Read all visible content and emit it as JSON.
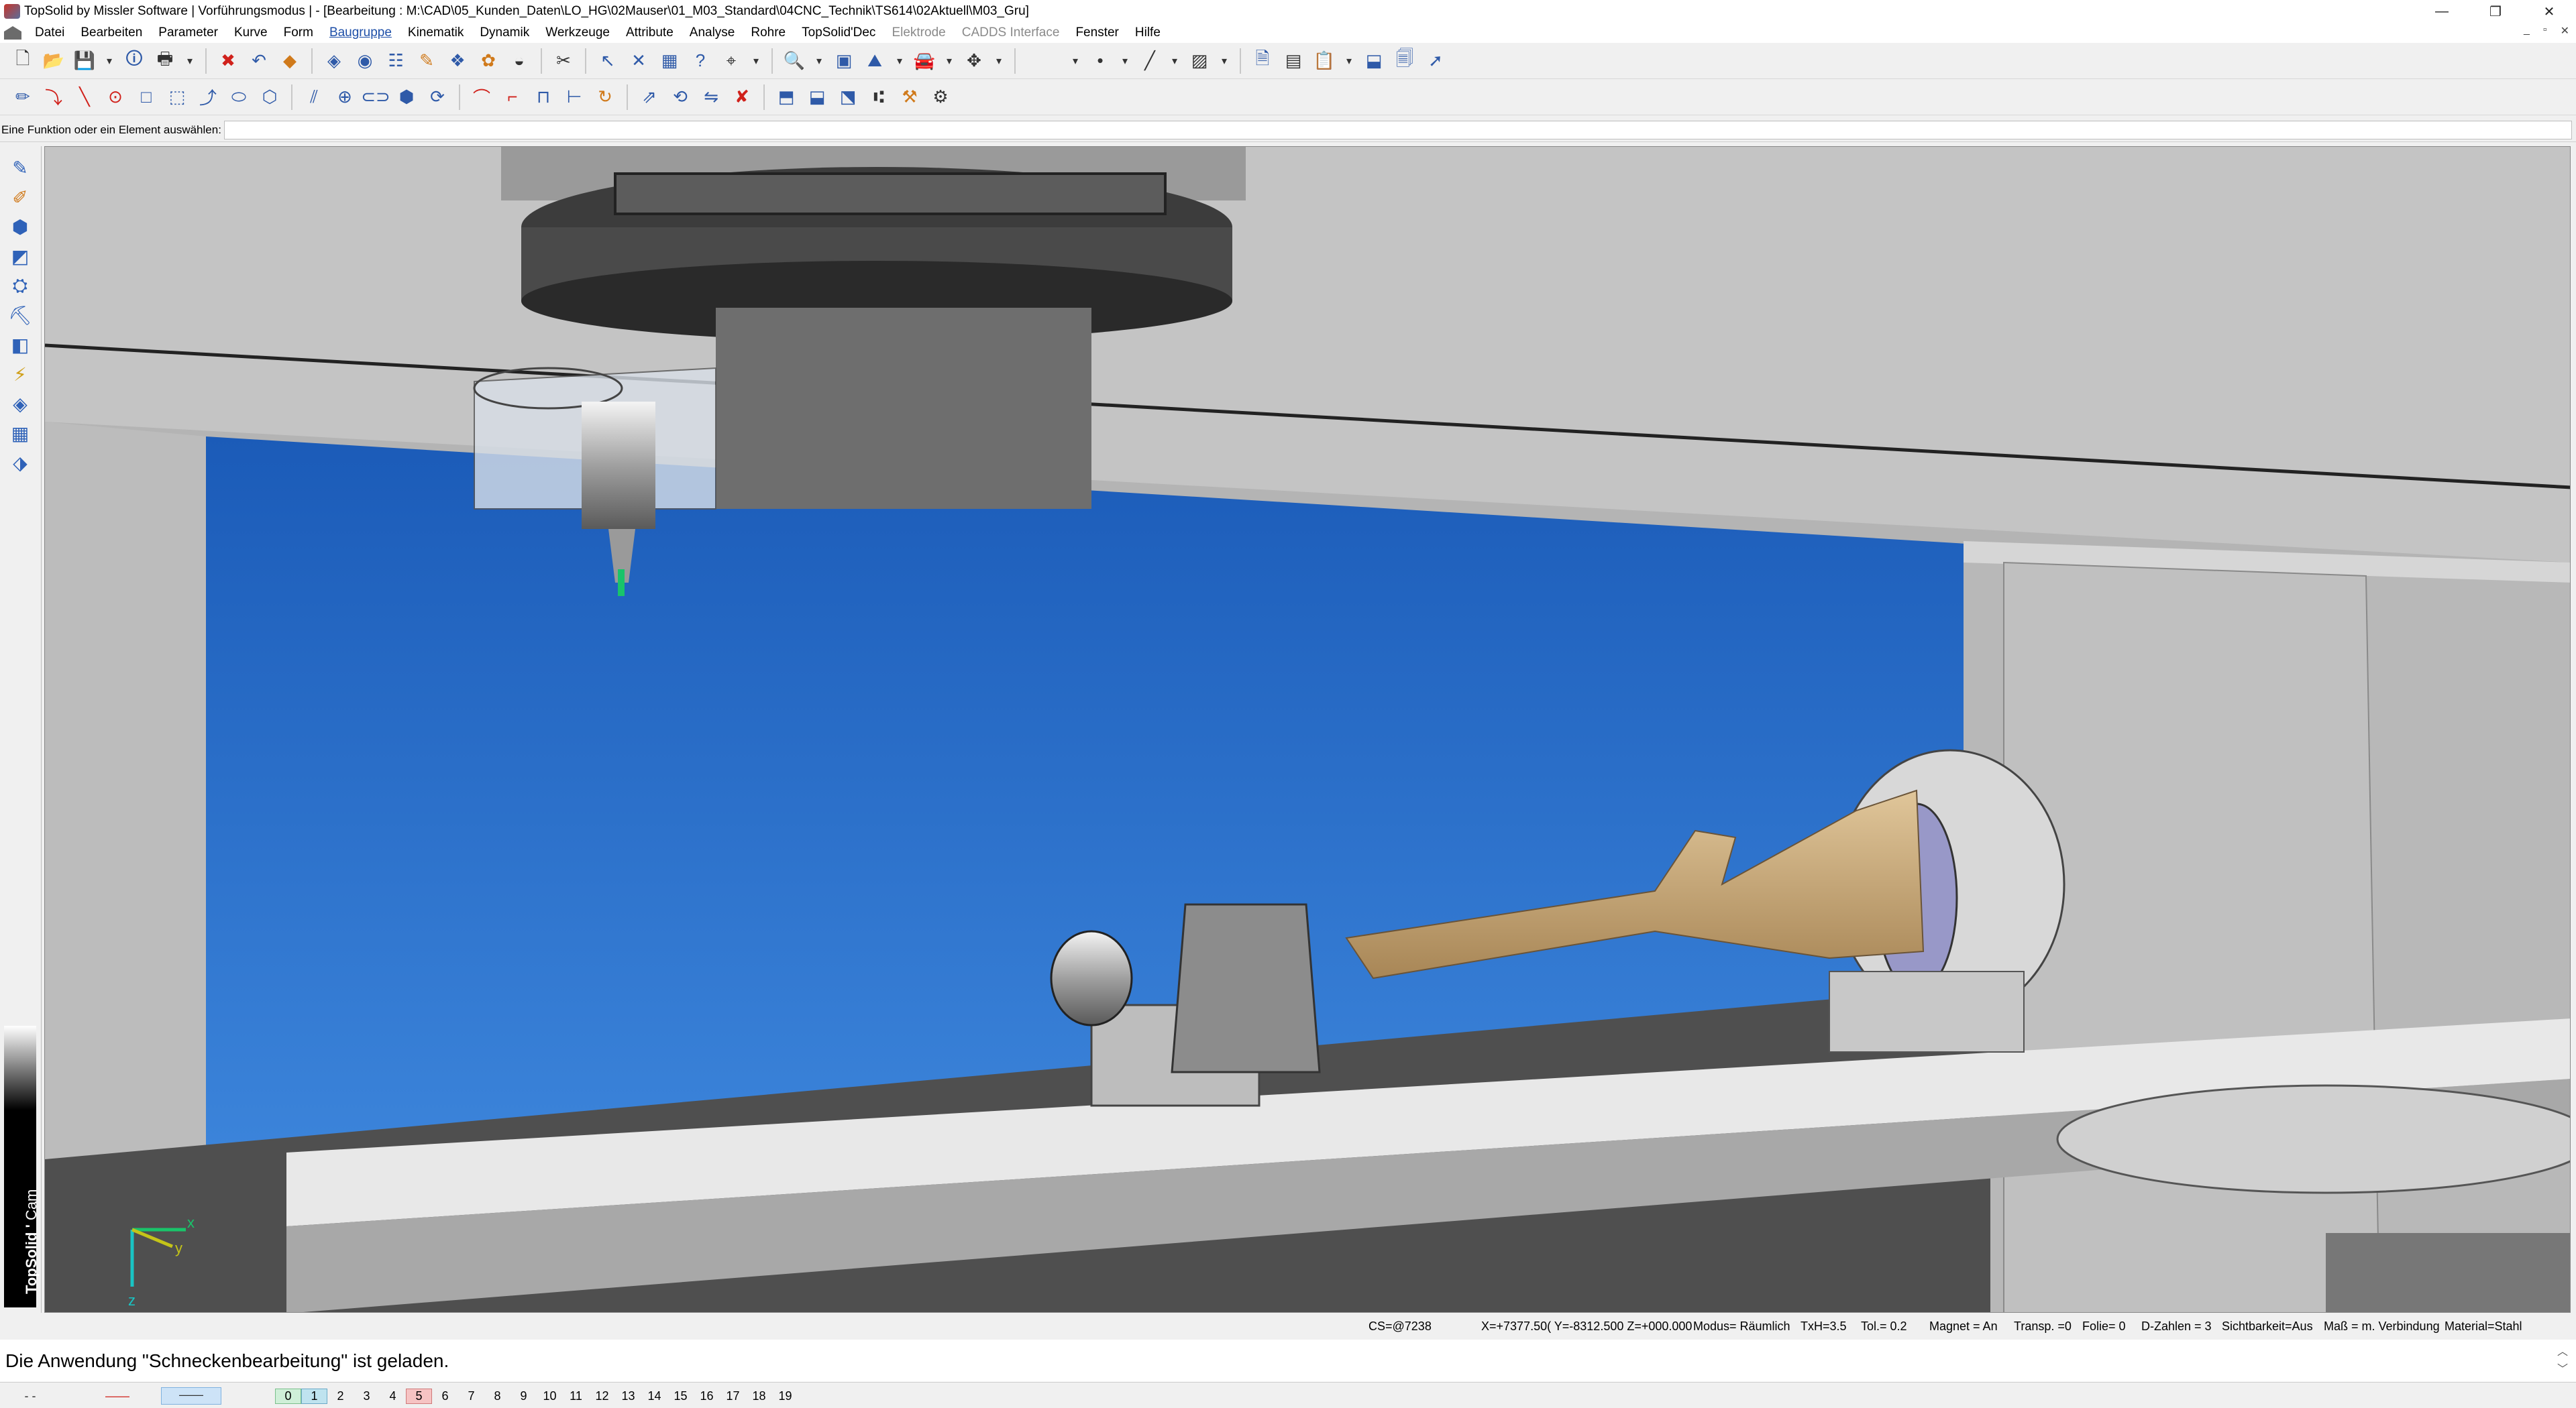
{
  "window": {
    "title": "TopSolid by Missler Software | Vorführungsmodus | - [Bearbeitung : M:\\CAD\\05_Kunden_Daten\\LO_HG\\02Mauser\\01_M03_Standard\\04CNC_Technik\\TS614\\02Aktuell\\M03_Gru]",
    "minimize": "—",
    "restore": "❐",
    "close": "✕"
  },
  "menu": {
    "items": [
      {
        "label": "Datei",
        "state": "normal"
      },
      {
        "label": "Bearbeiten",
        "state": "normal"
      },
      {
        "label": "Parameter",
        "state": "normal"
      },
      {
        "label": "Kurve",
        "state": "normal"
      },
      {
        "label": "Form",
        "state": "normal"
      },
      {
        "label": "Baugruppe",
        "state": "active"
      },
      {
        "label": "Kinematik",
        "state": "normal"
      },
      {
        "label": "Dynamik",
        "state": "normal"
      },
      {
        "label": "Werkzeuge",
        "state": "normal"
      },
      {
        "label": "Attribute",
        "state": "normal"
      },
      {
        "label": "Analyse",
        "state": "normal"
      },
      {
        "label": "Rohre",
        "state": "normal"
      },
      {
        "label": "TopSolid'Dec",
        "state": "normal"
      },
      {
        "label": "Elektrode",
        "state": "disabled"
      },
      {
        "label": "CADDS Interface",
        "state": "disabled"
      },
      {
        "label": "Fenster",
        "state": "normal"
      },
      {
        "label": "Hilfe",
        "state": "normal"
      }
    ],
    "mdi_minimize": "_",
    "mdi_restore": "▫",
    "mdi_close": "✕"
  },
  "prompt": {
    "label": "Eine Funktion oder ein Element auswählen:",
    "value": ""
  },
  "brand": {
    "name": "TopSolid",
    "module": "Cam"
  },
  "viewport": {
    "colors": {
      "blue_backplate": "#2a6cc4",
      "machine_grey": "#b8b8b8",
      "dark_grey": "#5a5a5a",
      "workpiece": "#c9a87a",
      "tool_tip": "#19c46a"
    },
    "axes": {
      "x": "x",
      "y": "y",
      "z": "z"
    }
  },
  "status": {
    "cs": "CS=@7238",
    "coords": "X=+7377.50( Y=-8312.500 Z=+000.000",
    "modus": "Modus= Räumlich",
    "txh": "TxH=3.5",
    "tol": "Tol.=  0.2",
    "magnet": "Magnet = An",
    "transp": "Transp. =0",
    "folie": "Folie=  0",
    "dzahlen": "D-Zahlen = 3",
    "sichtbarkeit": "Sichtbarkeit=Aus",
    "mass": "Maß = m. Verbindung",
    "material": "Material=Stahl"
  },
  "message": {
    "text": "Die Anwendung \"Schneckenbearbeitung\" ist geladen.",
    "up": "︿",
    "down": "﹀"
  },
  "layers": {
    "styles": [
      "- -",
      "——",
      "——"
    ],
    "numbers": [
      "0",
      "1",
      "2",
      "3",
      "4",
      "5",
      "6",
      "7",
      "8",
      "9",
      "10",
      "11",
      "12",
      "13",
      "14",
      "15",
      "16",
      "17",
      "18",
      "19"
    ]
  }
}
